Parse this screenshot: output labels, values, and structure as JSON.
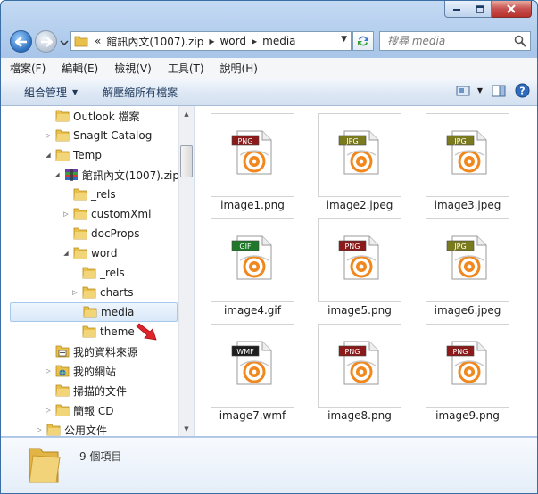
{
  "window": {
    "controls": {
      "minimize": "minimize-icon",
      "maximize": "maximize-icon",
      "close": "close-icon"
    }
  },
  "address": {
    "overflow": "«",
    "segments": [
      "館訊內文(1007).zip",
      "word",
      "media"
    ]
  },
  "search": {
    "placeholder": "搜尋 media"
  },
  "menu": [
    "檔案(F)",
    "編輯(E)",
    "檢視(V)",
    "工具(T)",
    "說明(H)"
  ],
  "commands": {
    "organize": "組合管理",
    "extract": "解壓縮所有檔案"
  },
  "tree": [
    {
      "label": "Outlook 檔案",
      "indent": 2,
      "expander": "none",
      "icon": "folder"
    },
    {
      "label": "SnagIt Catalog",
      "indent": 2,
      "expander": "collapsed",
      "icon": "folder"
    },
    {
      "label": "Temp",
      "indent": 2,
      "expander": "expanded",
      "icon": "folder"
    },
    {
      "label": "館訊內文(1007).zip",
      "indent": 3,
      "expander": "expanded",
      "icon": "zip"
    },
    {
      "label": "_rels",
      "indent": 4,
      "expander": "none",
      "icon": "folder"
    },
    {
      "label": "customXml",
      "indent": 4,
      "expander": "collapsed",
      "icon": "folder"
    },
    {
      "label": "docProps",
      "indent": 4,
      "expander": "none",
      "icon": "folder"
    },
    {
      "label": "word",
      "indent": 4,
      "expander": "expanded",
      "icon": "folder"
    },
    {
      "label": "_rels",
      "indent": 5,
      "expander": "none",
      "icon": "folder"
    },
    {
      "label": "charts",
      "indent": 5,
      "expander": "collapsed",
      "icon": "folder"
    },
    {
      "label": "media",
      "indent": 5,
      "expander": "none",
      "icon": "folder",
      "selected": true
    },
    {
      "label": "theme",
      "indent": 5,
      "expander": "none",
      "icon": "folder"
    },
    {
      "label": "我的資料來源",
      "indent": 2,
      "expander": "none",
      "icon": "datasource"
    },
    {
      "label": "我的網站",
      "indent": 2,
      "expander": "collapsed",
      "icon": "website"
    },
    {
      "label": "掃描的文件",
      "indent": 2,
      "expander": "none",
      "icon": "folder"
    },
    {
      "label": "簡報 CD",
      "indent": 2,
      "expander": "collapsed",
      "icon": "folder"
    },
    {
      "label": "公用文件",
      "indent": 1,
      "expander": "collapsed",
      "icon": "folder"
    }
  ],
  "files": [
    {
      "name": "image1.png",
      "badge": "PNG",
      "badgeColor": "#8b1a1a"
    },
    {
      "name": "image2.jpeg",
      "badge": "JPG",
      "badgeColor": "#7a7a1e"
    },
    {
      "name": "image3.jpeg",
      "badge": "JPG",
      "badgeColor": "#7a7a1e"
    },
    {
      "name": "image4.gif",
      "badge": "GIF",
      "badgeColor": "#1e7a2a"
    },
    {
      "name": "image5.png",
      "badge": "PNG",
      "badgeColor": "#8b1a1a"
    },
    {
      "name": "image6.jpeg",
      "badge": "JPG",
      "badgeColor": "#7a7a1e"
    },
    {
      "name": "image7.wmf",
      "badge": "WMF",
      "badgeColor": "#1e1e1e"
    },
    {
      "name": "image8.png",
      "badge": "PNG",
      "badgeColor": "#8b1a1a"
    },
    {
      "name": "image9.png",
      "badge": "PNG",
      "badgeColor": "#8b1a1a"
    }
  ],
  "details": {
    "count": "9 個項目"
  },
  "colors": {
    "folder": "#e8c04a",
    "accent": "#f0881e",
    "selection": "#d9e8f9"
  }
}
